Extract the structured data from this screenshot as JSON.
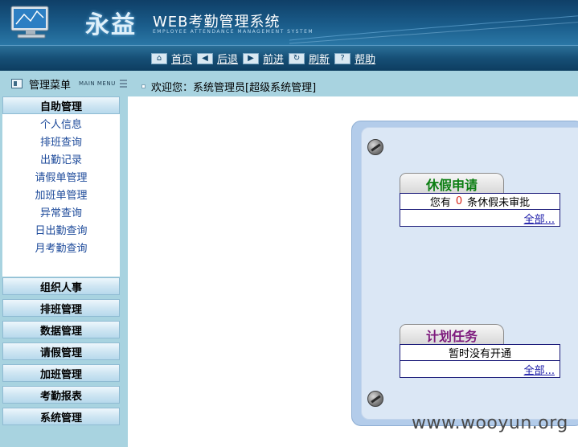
{
  "header": {
    "brand": "永益",
    "title": "WEB考勤管理系统",
    "subtitle": "EMPLOYEE ATTENDANCE MANAGEMENT SYSTEM"
  },
  "nav": {
    "items": [
      {
        "icon": "home-icon",
        "label": "首页"
      },
      {
        "icon": "arrow-left-icon",
        "label": "后退"
      },
      {
        "icon": "arrow-right-icon",
        "label": "前进"
      },
      {
        "icon": "refresh-icon",
        "label": "刷新"
      },
      {
        "icon": "help-icon",
        "label": "帮助"
      }
    ]
  },
  "sidebar": {
    "title": "管理菜单",
    "subtitle": "MAIN MENU",
    "active_section": "自助管理",
    "active_items": [
      "个人信息",
      "排班查询",
      "出勤记录",
      "请假单管理",
      "加班单管理",
      "异常查询",
      "日出勤查询",
      "月考勤查询"
    ],
    "sections": [
      "组织人事",
      "排班管理",
      "数据管理",
      "请假管理",
      "加班管理",
      "考勤报表",
      "系统管理"
    ]
  },
  "welcome": {
    "text": "欢迎您：系统管理员[超级系统管理]"
  },
  "panels": {
    "leave": {
      "tab": "休假申请",
      "prefix": "您有",
      "count": "0",
      "suffix": "条休假未审批",
      "link": "全部..."
    },
    "plan": {
      "tab": "计划任务",
      "message": "暂时没有开通",
      "link": "全部..."
    }
  },
  "watermark": "www.wooyun.org"
}
